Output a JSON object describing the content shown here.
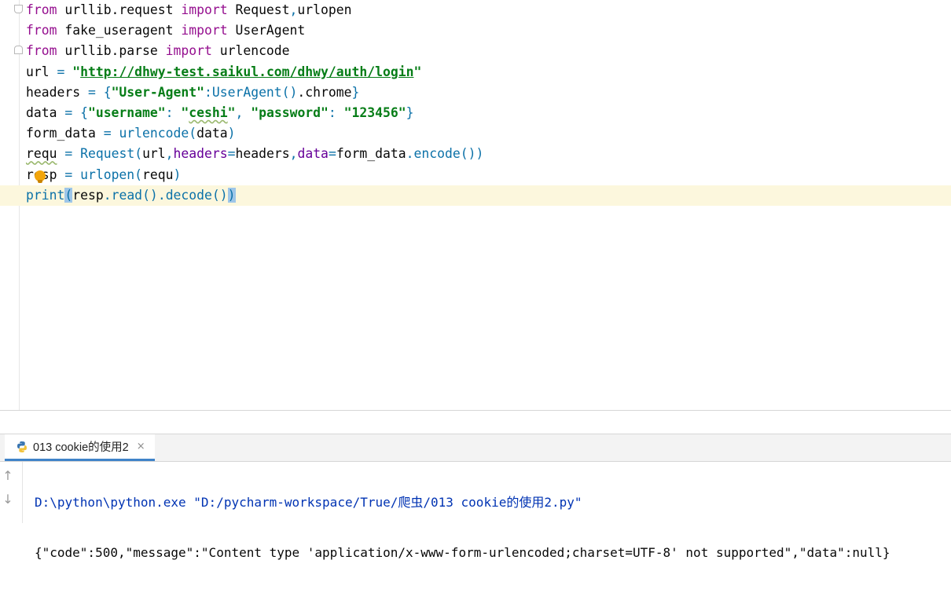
{
  "editor": {
    "lines": [
      {
        "tokens": [
          {
            "t": "from",
            "c": "kw2"
          },
          {
            "t": " urllib.request ",
            "c": ""
          },
          {
            "t": "import",
            "c": "kw2"
          },
          {
            "t": " Request",
            "c": ""
          },
          {
            "t": ",",
            "c": "punc"
          },
          {
            "t": "urlopen",
            "c": ""
          }
        ]
      },
      {
        "tokens": [
          {
            "t": "from",
            "c": "kw2"
          },
          {
            "t": " fake_useragent ",
            "c": ""
          },
          {
            "t": "import",
            "c": "kw2"
          },
          {
            "t": " UserAgent",
            "c": ""
          }
        ]
      },
      {
        "tokens": [
          {
            "t": "from",
            "c": "kw2"
          },
          {
            "t": " urllib.parse ",
            "c": ""
          },
          {
            "t": "import",
            "c": "kw2"
          },
          {
            "t": " urlencode",
            "c": ""
          }
        ]
      },
      {
        "tokens": [
          {
            "t": "url ",
            "c": ""
          },
          {
            "t": "= ",
            "c": "punc"
          },
          {
            "t": "\"",
            "c": "str"
          },
          {
            "t": "http://dhwy-test.saikul.com/dhwy/auth/login",
            "c": "url"
          },
          {
            "t": "\"",
            "c": "str"
          }
        ]
      },
      {
        "tokens": [
          {
            "t": "headers ",
            "c": ""
          },
          {
            "t": "= {",
            "c": "punc"
          },
          {
            "t": "\"User-Agent\"",
            "c": "str"
          },
          {
            "t": ":",
            "c": "punc"
          },
          {
            "t": "UserAgent",
            "c": "cls"
          },
          {
            "t": "()",
            "c": "punc"
          },
          {
            "t": ".chrome",
            "c": ""
          },
          {
            "t": "}",
            "c": "punc"
          }
        ]
      },
      {
        "tokens": [
          {
            "t": "data ",
            "c": ""
          },
          {
            "t": "= {",
            "c": "punc"
          },
          {
            "t": "\"username\"",
            "c": "str"
          },
          {
            "t": ": ",
            "c": "punc"
          },
          {
            "t": "\"",
            "c": "str"
          },
          {
            "t": "ceshi",
            "c": "str wavy"
          },
          {
            "t": "\"",
            "c": "str"
          },
          {
            "t": ", ",
            "c": "punc"
          },
          {
            "t": "\"password\"",
            "c": "str"
          },
          {
            "t": ": ",
            "c": "punc"
          },
          {
            "t": "\"123456\"",
            "c": "str"
          },
          {
            "t": "}",
            "c": "punc"
          }
        ]
      },
      {
        "tokens": [
          {
            "t": "form_data ",
            "c": ""
          },
          {
            "t": "= ",
            "c": "punc"
          },
          {
            "t": "urlencode",
            "c": "fn"
          },
          {
            "t": "(",
            "c": "punc"
          },
          {
            "t": "data",
            "c": ""
          },
          {
            "t": ")",
            "c": "punc"
          }
        ]
      },
      {
        "tokens": [
          {
            "t": "requ",
            "c": "wavy"
          },
          {
            "t": " ",
            "c": ""
          },
          {
            "t": "= ",
            "c": "punc"
          },
          {
            "t": "Request",
            "c": "cls"
          },
          {
            "t": "(",
            "c": "punc"
          },
          {
            "t": "url",
            "c": ""
          },
          {
            "t": ",",
            "c": "punc"
          },
          {
            "t": "headers",
            "c": "param"
          },
          {
            "t": "=",
            "c": "punc"
          },
          {
            "t": "headers",
            "c": ""
          },
          {
            "t": ",",
            "c": "punc"
          },
          {
            "t": "data",
            "c": "param"
          },
          {
            "t": "=",
            "c": "punc"
          },
          {
            "t": "form_data",
            "c": ""
          },
          {
            "t": ".",
            "c": "punc"
          },
          {
            "t": "encode",
            "c": "fn"
          },
          {
            "t": "())",
            "c": "punc"
          }
        ]
      },
      {
        "tokens": [
          {
            "t": "resp ",
            "c": ""
          },
          {
            "t": "= ",
            "c": "punc"
          },
          {
            "t": "urlopen",
            "c": "fn"
          },
          {
            "t": "(",
            "c": "punc"
          },
          {
            "t": "requ",
            "c": ""
          },
          {
            "t": ")",
            "c": "punc"
          }
        ]
      },
      {
        "current": true,
        "tokens": [
          {
            "t": "print",
            "c": "fn"
          },
          {
            "t": "(",
            "c": "punc bm"
          },
          {
            "t": "resp",
            "c": ""
          },
          {
            "t": ".",
            "c": "punc"
          },
          {
            "t": "read",
            "c": "fn"
          },
          {
            "t": "()",
            "c": "punc"
          },
          {
            "t": ".",
            "c": "punc"
          },
          {
            "t": "decode",
            "c": "fn"
          },
          {
            "t": "()",
            "c": "punc"
          },
          {
            "t": ")",
            "c": "punc bm"
          }
        ]
      }
    ]
  },
  "run_panel": {
    "tab_label": "013 cookie的使用2",
    "tab_close": "×",
    "tab_icon": "python-icon",
    "toolbar": {
      "up": "↑",
      "down": "↓"
    },
    "console": {
      "command": "D:\\python\\python.exe \"D:/pycharm-workspace/True/爬虫/013 cookie的使用2.py\"",
      "output": "{\"code\":500,\"message\":\"Content type 'application/x-www-form-urlencoded;charset=UTF-8' not supported\",\"data\":null}"
    }
  },
  "colors": {
    "keyword": "#950f8f",
    "string": "#067d17",
    "function": "#0b71a8",
    "current_line": "#fcf7dd",
    "tab_underline": "#4083c9"
  }
}
